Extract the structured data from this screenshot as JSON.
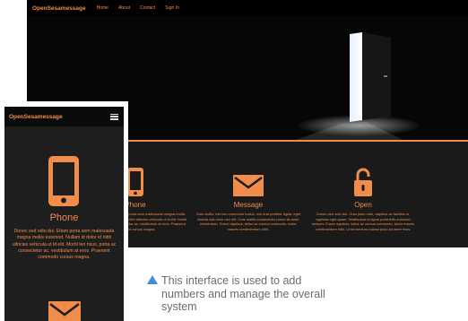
{
  "desktop": {
    "brand": "OpenSesamessage",
    "nav": [
      "Home",
      "About",
      "Contact",
      "Sign In"
    ],
    "features": [
      {
        "icon": "phone-icon",
        "title": "Phone",
        "text": "Donec sed odio dui. Etiam porta sem malesuada magna mollis euismod. Nullam id dolor id nibh ultricies vehicula ut id elit. Morbi leo risus, porta ac consectetur ac, vestibulum at eros. Praesent commodo cursus magna."
      },
      {
        "icon": "envelope-icon",
        "title": "Message",
        "text": "Duis mollis, est non commodo luctus, nisi erat porttitor ligula, eget lacinia odio sem nec elit. Cras mattis consectetur purus sit amet fermentum. Fusce dapibus, tellus ac cursus commodo, tortor mauris condimentum nibh."
      },
      {
        "icon": "padlock-icon",
        "title": "Open",
        "text": "Donec sed odio dui. Cras justo odio, dapibus ac facilisis in, egestas eget quam. Vestibulum id ligula porta felis euismod semper. Fusce dapibus, tellus ac cursus commodo, tortor mauris condimentum nibh, ut fermentum massa justo sit amet risus."
      }
    ]
  },
  "mobile": {
    "brand": "OpenSesamessage",
    "feature_title": "Phone",
    "feature_text": "Donec sed odio dui. Etiam porta sem malesuada magna mollis euismod. Nullam id dolor id nibh ultricies vehicula ut id elit. Morbi leo risus, porta ac consectetur ac, vestibulum at eros. Praesent commodo cursus magna."
  },
  "caption": "This interface is used to add numbers and manage the overall system",
  "colors": {
    "accent": "#f28c4b",
    "caption_marker": "#3a8fd8",
    "dark": "#1a1a1a"
  }
}
